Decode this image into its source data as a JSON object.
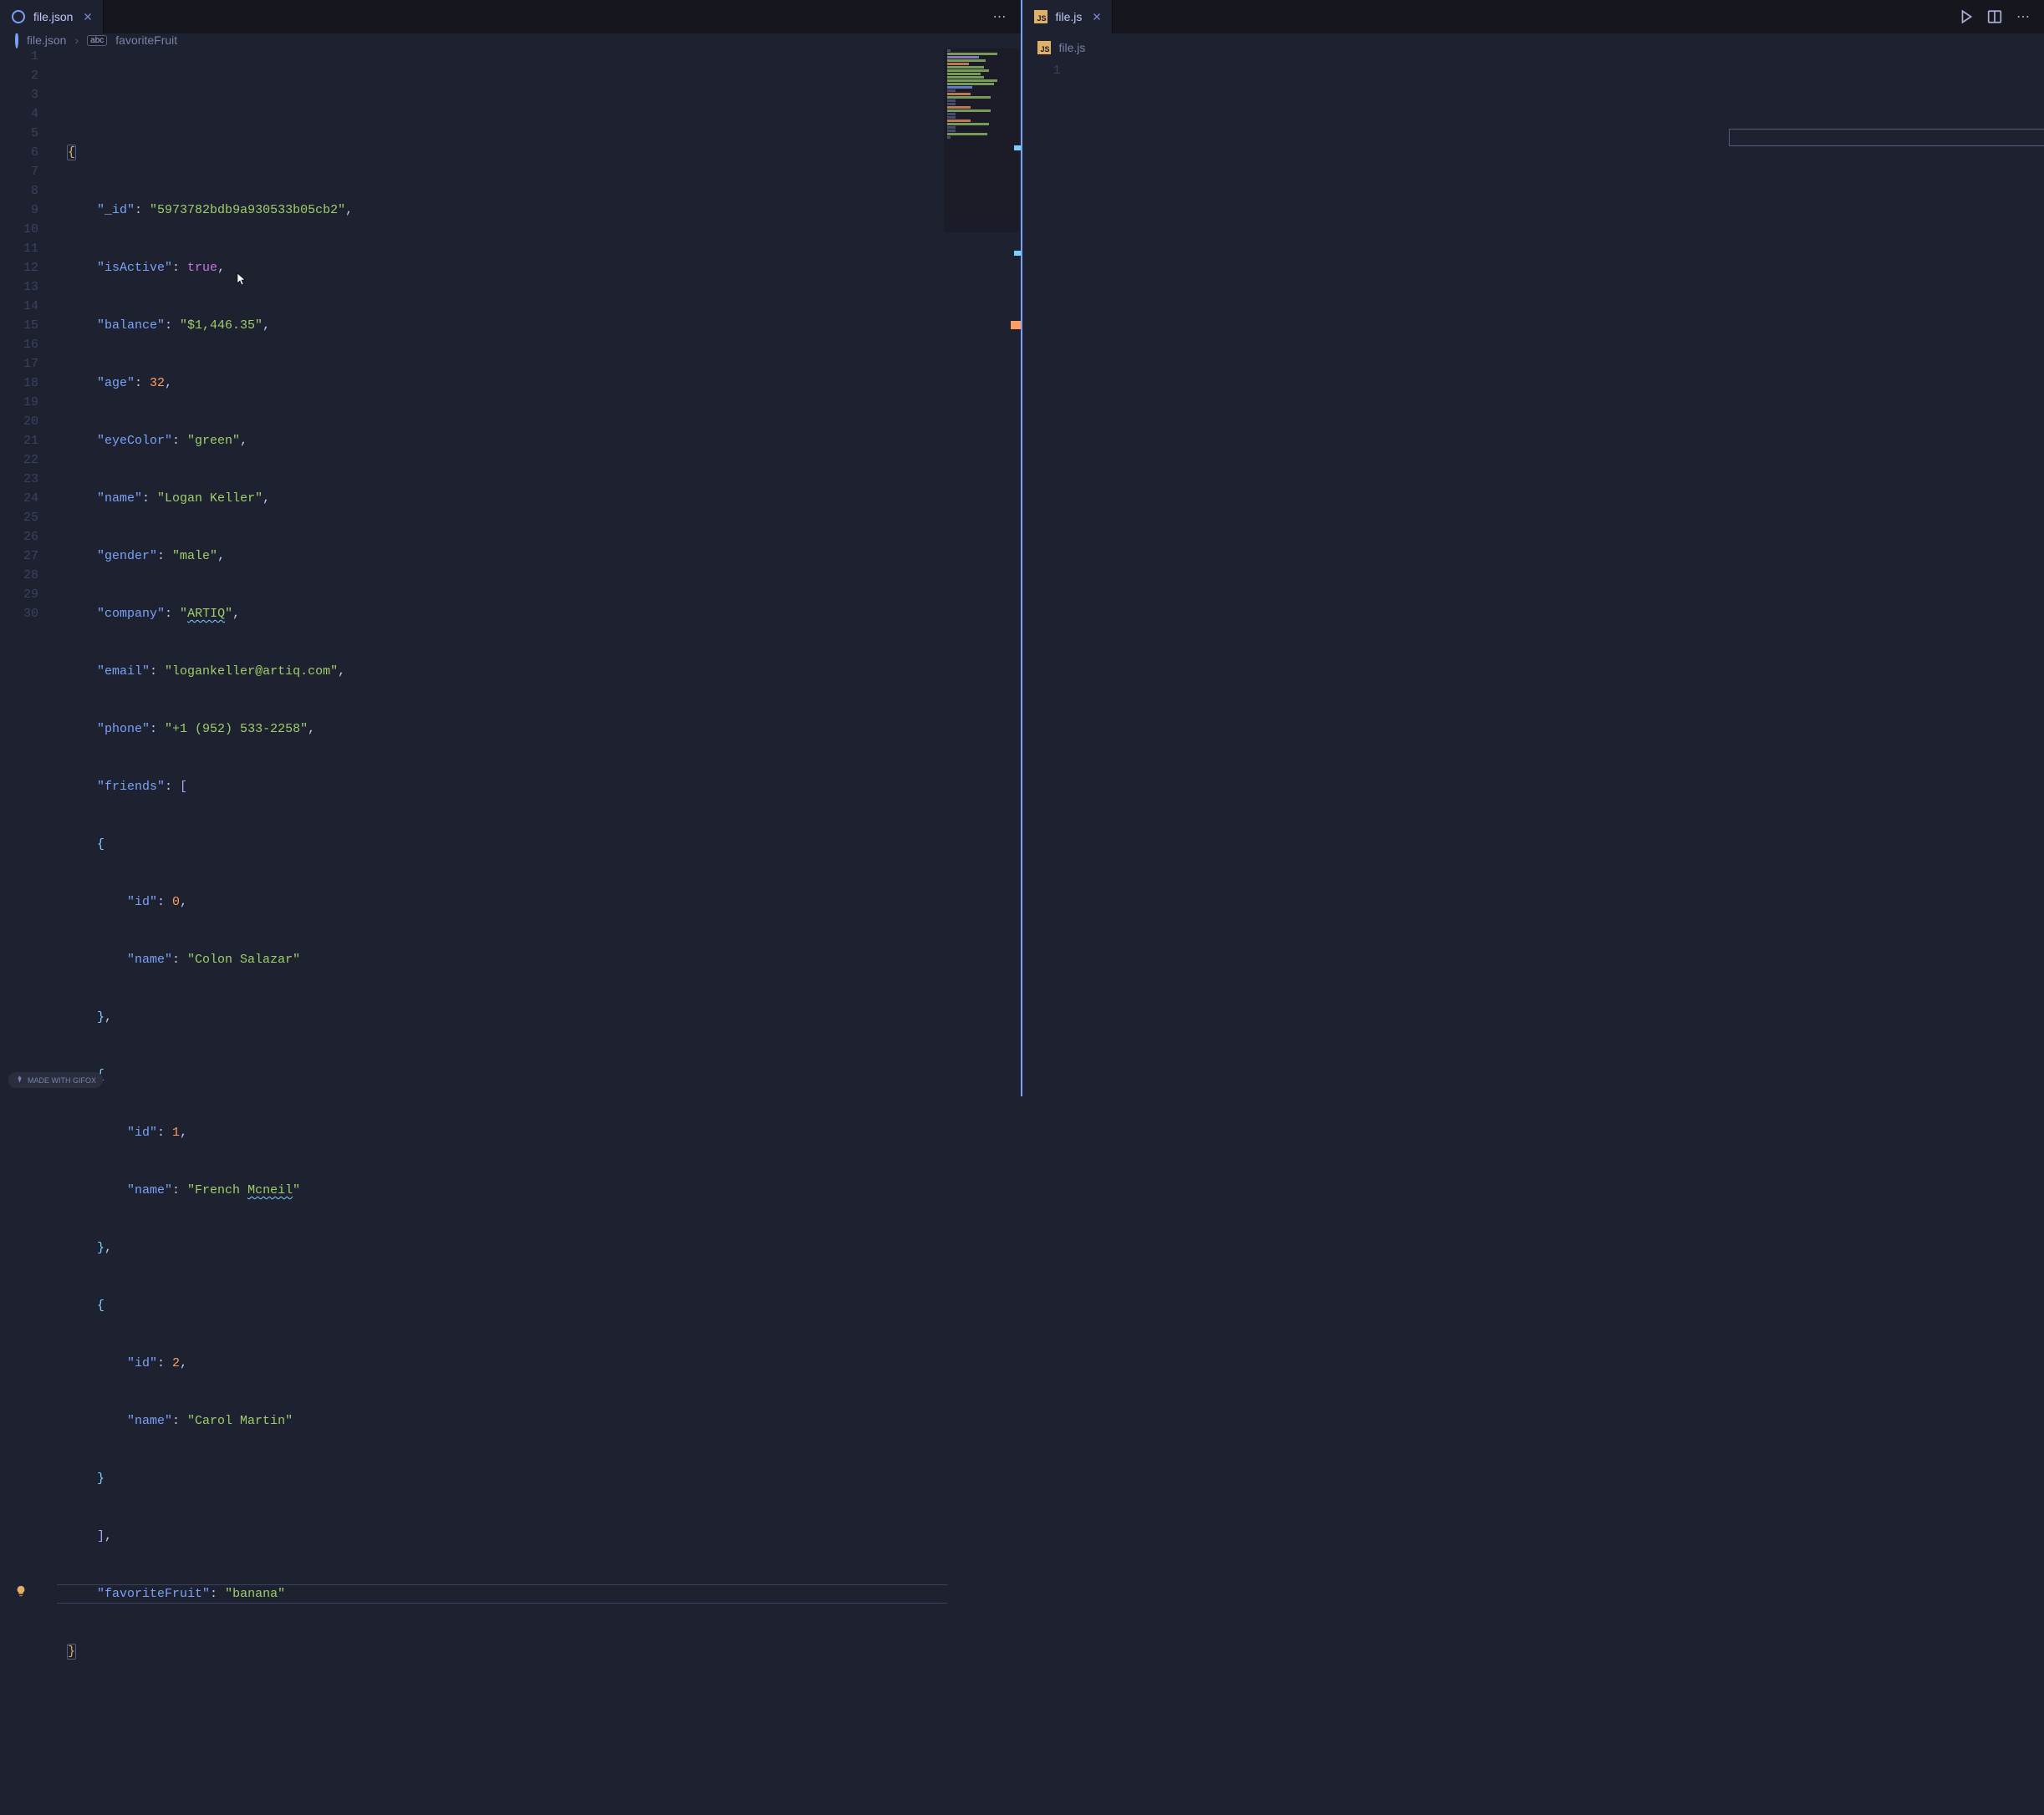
{
  "leftPane": {
    "tab": {
      "label": "file.json"
    },
    "tabActions": {
      "more": "⋯"
    },
    "breadcrumb": {
      "file": "file.json",
      "sep": "›",
      "symbol": "favoriteFruit",
      "symbolBadge": "abc"
    },
    "lineCount": 30,
    "highlightedLine": 27,
    "code": {
      "l3": {
        "k": "\"_id\"",
        "v": "\"5973782bdb9a930533b05cb2\""
      },
      "l4": {
        "k": "\"isActive\"",
        "v": "true"
      },
      "l5": {
        "k": "\"balance\"",
        "v": "\"$1,446.35\""
      },
      "l6": {
        "k": "\"age\"",
        "v": "32"
      },
      "l7": {
        "k": "\"eyeColor\"",
        "v": "\"green\""
      },
      "l8": {
        "k": "\"name\"",
        "v": "\"Logan Keller\""
      },
      "l9": {
        "k": "\"gender\"",
        "v": "\"male\""
      },
      "l10": {
        "k": "\"company\"",
        "v": "\"ARTIQ\""
      },
      "l11": {
        "k": "\"email\"",
        "v": "\"logankeller@artiq.com\""
      },
      "l12": {
        "k": "\"phone\"",
        "v": "\"+1 (952) 533-2258\""
      },
      "l13": {
        "k": "\"friends\""
      },
      "l15": {
        "k": "\"id\"",
        "v": "0"
      },
      "l16": {
        "k": "\"name\"",
        "v": "\"Colon Salazar\""
      },
      "l19": {
        "k": "\"id\"",
        "v": "1"
      },
      "l20": {
        "k": "\"name\"",
        "va": "\"French ",
        "vb": "Mcneil",
        "vc": "\""
      },
      "l23": {
        "k": "\"id\"",
        "v": "2"
      },
      "l24": {
        "k": "\"name\"",
        "v": "\"Carol Martin\""
      },
      "l27": {
        "k": "\"favoriteFruit\"",
        "v": "\"banana\""
      }
    }
  },
  "rightPane": {
    "tab": {
      "label": "file.js"
    },
    "breadcrumb": {
      "file": "file.js"
    },
    "lineNumbers": [
      "1"
    ]
  },
  "watermark": "MADE WITH GIFOX"
}
